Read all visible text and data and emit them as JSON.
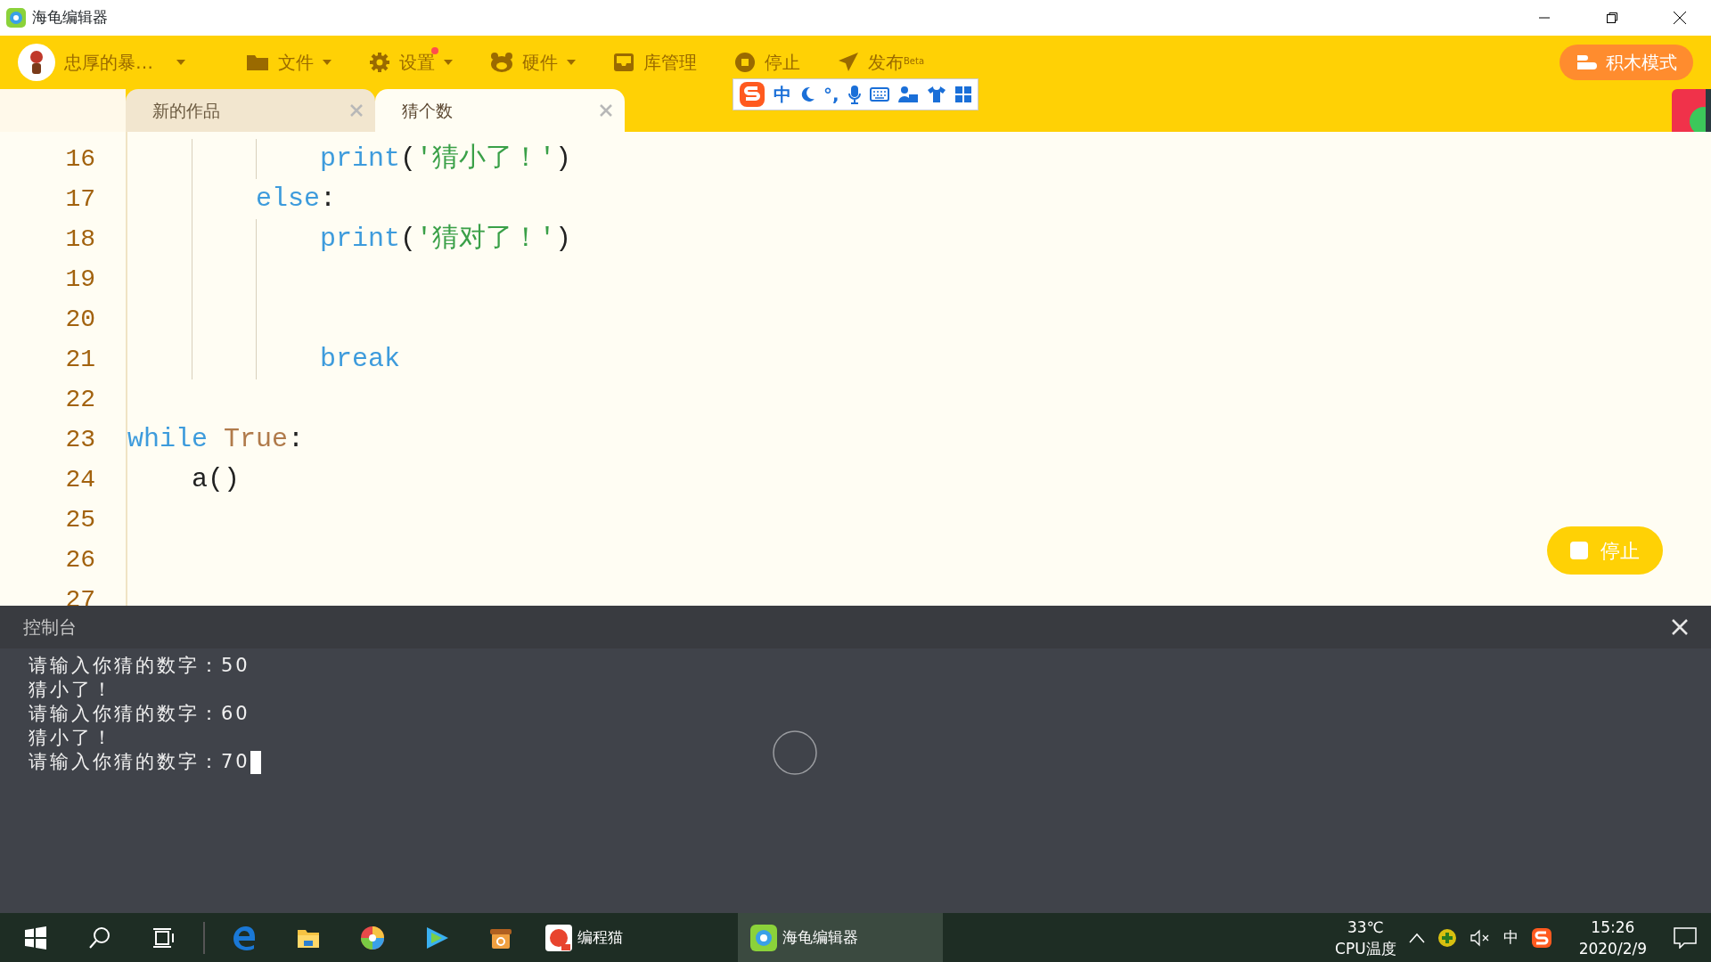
{
  "window": {
    "title": "海龟编辑器"
  },
  "toolbar": {
    "user_name": "忠厚的暴…",
    "menus": [
      {
        "kind": "folder",
        "label": "文件",
        "dropdown": true,
        "notification": false
      },
      {
        "kind": "gear",
        "label": "设置",
        "dropdown": true,
        "notification": true
      },
      {
        "kind": "hardware",
        "label": "硬件",
        "dropdown": true,
        "notification": false
      },
      {
        "kind": "inbox",
        "label": "库管理",
        "dropdown": false,
        "notification": false
      },
      {
        "kind": "stop",
        "label": "停止",
        "dropdown": false,
        "notification": false
      },
      {
        "kind": "send",
        "label": "发布$^{Beta}$",
        "dropdown": false,
        "notification": false
      }
    ],
    "mode_button": "积木模式"
  },
  "ime_bar": {
    "mode": "中",
    "punctuation": "°,"
  },
  "tabs": [
    {
      "label": "新的作品",
      "selected": false
    },
    {
      "label": "猜个数",
      "selected": true
    }
  ],
  "editor": {
    "lines": [
      {
        "children": [
          {
            "children": [
              {
                "children": [
                  {
                    "number": "16",
                    "code": [
                      {
                        "kind": "keyword",
                        "text": "print"
                      },
                      {
                        "kind": "plain",
                        "text": "("
                      },
                      {
                        "kind": "string",
                        "text": "'猜小了！'"
                      },
                      {
                        "kind": "plain",
                        "text": ")"
                      }
                    ]
                  }
                ]
              },
              {
                "number": "17",
                "code": [
                  {
                    "kind": "keyword",
                    "text": "else"
                  },
                  {
                    "kind": "plain",
                    "text": ":"
                  }
                ],
                "children": [
                  {
                    "number": "18",
                    "code": [
                      {
                        "kind": "keyword",
                        "text": "print"
                      },
                      {
                        "kind": "plain",
                        "text": "("
                      },
                      {
                        "kind": "string",
                        "text": "'猜对了！'"
                      },
                      {
                        "kind": "plain",
                        "text": ")"
                      }
                    ]
                  },
                  {
                    "number": "19"
                  },
                  {
                    "number": "20"
                  },
                  {
                    "number": "21",
                    "code": [
                      {
                        "kind": "keyword",
                        "text": "break"
                      }
                    ]
                  }
                ]
              }
            ]
          }
        ]
      },
      {
        "number": "22"
      },
      {
        "number": "23",
        "code": [
          {
            "kind": "keyword",
            "text": "while"
          },
          {
            "kind": "constant",
            "text": "True",
            "space_before": true
          },
          {
            "kind": "plain",
            "text": ":"
          }
        ],
        "children": [
          {
            "number": "24",
            "code": [
              {
                "kind": "plain",
                "text": "a()"
              }
            ]
          }
        ]
      },
      {
        "number": "25"
      },
      {
        "number": "26"
      },
      {
        "number": "27"
      }
    ],
    "stop_button": "停止"
  },
  "console": {
    "title": "控制台",
    "lines": [
      "请输入你猜的数字：50",
      "猜小了！",
      "请输入你猜的数字：60",
      "猜小了！",
      "请输入你猜的数字：70"
    ],
    "cursor": true
  },
  "taskbar": {
    "apps": [
      {
        "label": "编程猫",
        "selected": false
      },
      {
        "label": "海龟编辑器",
        "selected": true
      }
    ],
    "tray": {
      "temperature": "33℃",
      "temperature_label": "CPU温度",
      "input_mode": "中",
      "time": "15:26",
      "date": "2020/2/9"
    }
  }
}
